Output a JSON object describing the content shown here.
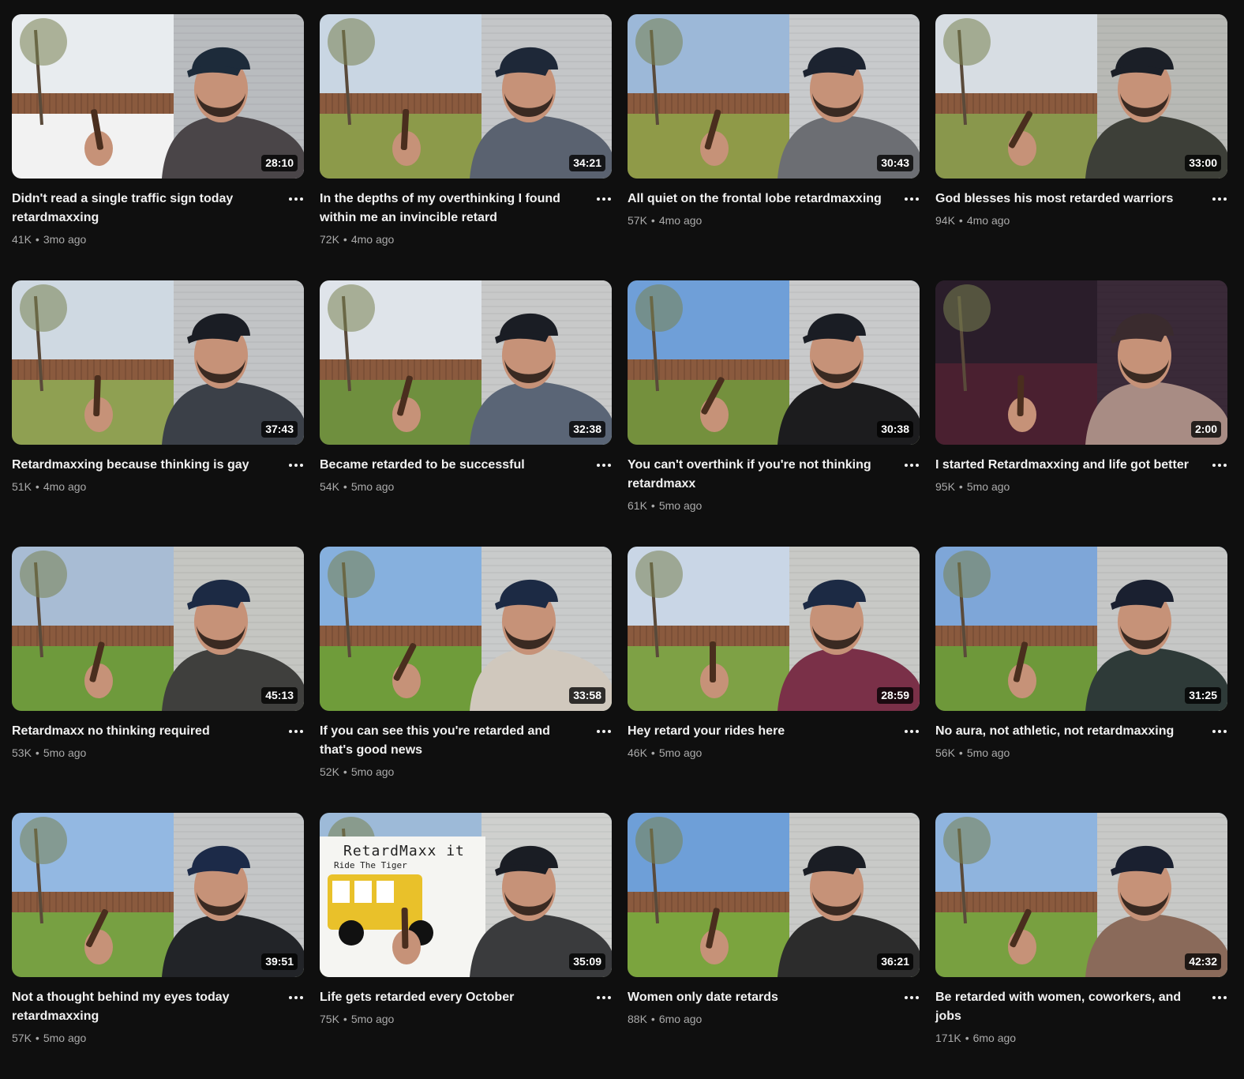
{
  "videos": [
    {
      "title": "Didn't read a single traffic sign today retardmaxxing",
      "views": "41K",
      "age": "3mo ago",
      "duration": "28:10"
    },
    {
      "title": "In the depths of my overthinking I found within me an invincible retard",
      "views": "72K",
      "age": "4mo ago",
      "duration": "34:21"
    },
    {
      "title": "All quiet on the frontal lobe retardmaxxing",
      "views": "57K",
      "age": "4mo ago",
      "duration": "30:43"
    },
    {
      "title": "God blesses his most retarded warriors",
      "views": "94K",
      "age": "4mo ago",
      "duration": "33:00"
    },
    {
      "title": "Retardmaxxing because thinking is gay",
      "views": "51K",
      "age": "4mo ago",
      "duration": "37:43"
    },
    {
      "title": "Became retarded to be successful",
      "views": "54K",
      "age": "5mo ago",
      "duration": "32:38"
    },
    {
      "title": "You can't overthink if you're not thinking retardmaxx",
      "views": "61K",
      "age": "5mo ago",
      "duration": "30:38"
    },
    {
      "title": "I started Retardmaxxing and life got better",
      "views": "95K",
      "age": "5mo ago",
      "duration": "2:00"
    },
    {
      "title": "Retardmaxx no thinking required",
      "views": "53K",
      "age": "5mo ago",
      "duration": "45:13"
    },
    {
      "title": "If you can see this you're retarded and that's good news",
      "views": "52K",
      "age": "5mo ago",
      "duration": "33:58"
    },
    {
      "title": "Hey retard your rides here",
      "views": "46K",
      "age": "5mo ago",
      "duration": "28:59"
    },
    {
      "title": "No aura, not athletic, not retardmaxxing",
      "views": "56K",
      "age": "5mo ago",
      "duration": "31:25"
    },
    {
      "title": "Not a thought behind my eyes today retardmaxxing",
      "views": "57K",
      "age": "5mo ago",
      "duration": "39:51"
    },
    {
      "title": "Life gets retarded every October",
      "views": "75K",
      "age": "5mo ago",
      "duration": "35:09"
    },
    {
      "title": "Women only date retards",
      "views": "88K",
      "age": "6mo ago",
      "duration": "36:21"
    },
    {
      "title": "Be retarded with women, coworkers, and jobs",
      "views": "171K",
      "age": "6mo ago",
      "duration": "42:32"
    }
  ],
  "sign": {
    "line1": "RetardMaxx it",
    "line2": "Ride The Tiger"
  },
  "icons": {
    "more": "more-vert-icon"
  },
  "colors": {
    "background": "#0f0f0f",
    "title": "#f1f1f1",
    "meta": "#aaaaaa"
  }
}
